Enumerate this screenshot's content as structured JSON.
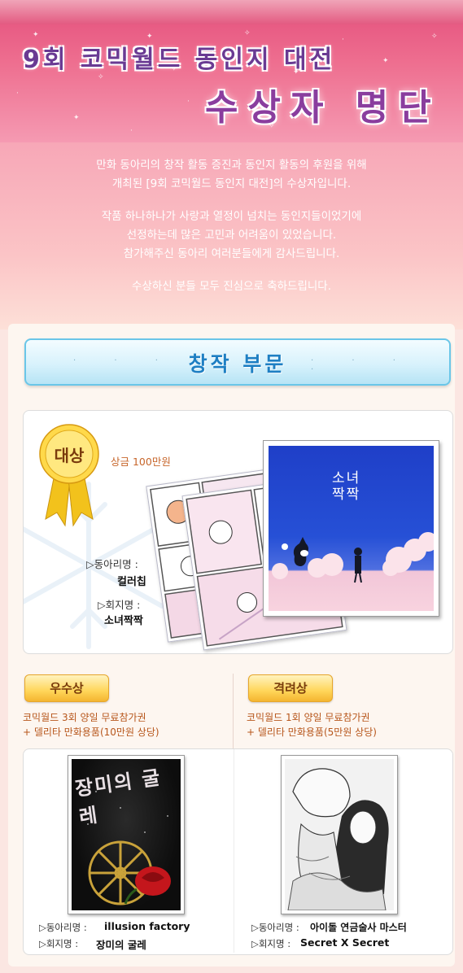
{
  "header": {
    "event_title": "9회 코믹월드 동인지 대전",
    "winners_title": "수상자 명단"
  },
  "intro": {
    "para1_line1": "만화 동아리의 창작 활동 증진과 동인지 활동의 후원을 위해",
    "para1_line2": "개최된 [9회 코믹월드 동인지 대전]의 수상자입니다.",
    "para2_line1": "작품 하나하나가 사랑과 열정이 넘치는 동인지들이었기에",
    "para2_line2": "선정하는데 많은 고민과 어려움이 있었습니다.",
    "para2_line3": "참가해주신 동아리 여러분들에게 감사드립니다.",
    "para3_line1": "수상하신 분들 모두 진심으로 축하드립니다."
  },
  "category": {
    "title": "창작 부문"
  },
  "grand_prize": {
    "badge": "대상",
    "prize": "상금 100만원",
    "circle_label": "▷동아리명 :",
    "circle_name": "컬러칩",
    "book_label": "▷회지명 :",
    "book_name": "소녀짝짝",
    "cover_title_line1": "소녀",
    "cover_title_line2": "짝짝"
  },
  "excellence": {
    "badge": "우수상",
    "prize_line1": "코믹월드 3회 양일 무료참가권",
    "prize_line2": "+ 델리타 만화용품(10만원 상당)",
    "circle_label": "▷동아리명 :",
    "circle_name": "illusion factory",
    "book_label": "▷회지명 :",
    "book_name": "장미의 굴레",
    "cover_title": "장미의 굴레"
  },
  "encouragement": {
    "badge": "격려상",
    "prize_line1": "코믹월드 1회 양일 무료참가권",
    "prize_line2": "+ 델리타 만화용품(5만원 상당)",
    "circle_label": "▷동아리명 :",
    "circle_name": "아이돌 연금술사 마스터",
    "book_label": "▷회지명 :",
    "book_name": "Secret X Secret"
  }
}
